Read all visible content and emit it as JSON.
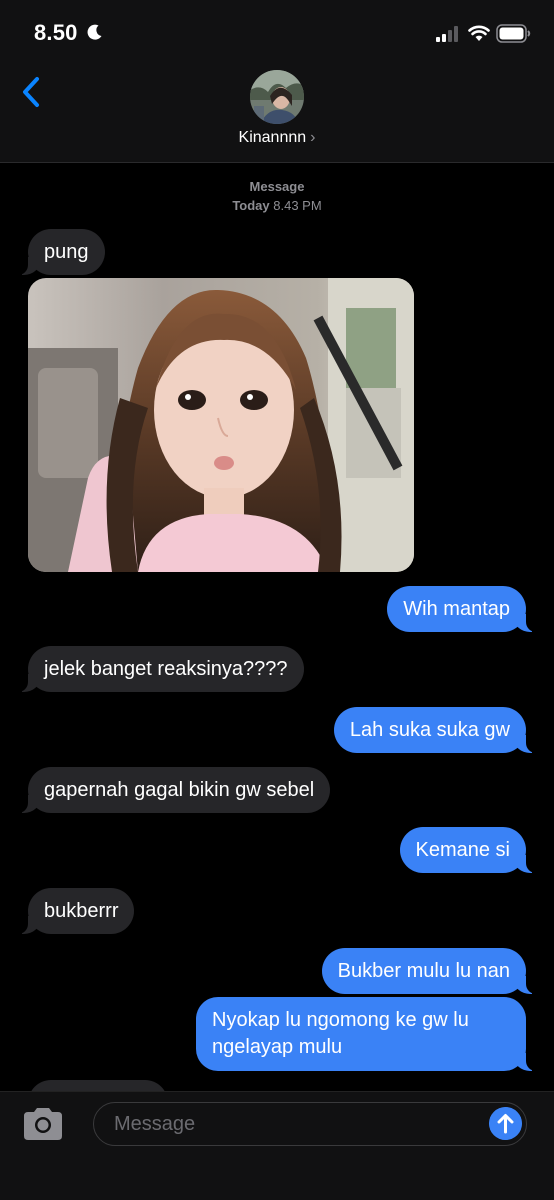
{
  "status_bar": {
    "time": "8.50",
    "moon_icon": "moon-icon",
    "signal_icon": "cellular-signal-icon",
    "wifi_icon": "wifi-icon",
    "battery_icon": "battery-icon"
  },
  "header": {
    "back_icon": "chevron-left-icon",
    "contact_name": "Kinannnn",
    "chevron": "›"
  },
  "conversation": {
    "service_label": "Message",
    "day_label": "Today",
    "time_label": "8.43 PM",
    "messages": [
      {
        "direction": "incoming",
        "text": "pung"
      },
      {
        "direction": "incoming",
        "type": "photo"
      },
      {
        "direction": "outgoing",
        "text": "Wih mantap"
      },
      {
        "direction": "incoming",
        "text": "jelek banget reaksinya????"
      },
      {
        "direction": "outgoing",
        "text": "Lah suka suka gw"
      },
      {
        "direction": "incoming",
        "text": "gapernah gagal bikin gw sebel"
      },
      {
        "direction": "outgoing",
        "text": "Kemane si"
      },
      {
        "direction": "incoming",
        "text": "bukberrr"
      },
      {
        "direction": "outgoing",
        "text": "Bukber mulu lu nan"
      },
      {
        "direction": "outgoing",
        "text": "Nyokap lu ngomong ke gw lu ngelayap mulu"
      }
    ]
  },
  "composer": {
    "placeholder": "Message",
    "camera_icon": "camera-icon",
    "send_icon": "arrow-up-icon"
  },
  "colors": {
    "outgoing_bubble": "#3a82f6",
    "incoming_bubble": "#262629",
    "accent": "#0a84ff"
  }
}
